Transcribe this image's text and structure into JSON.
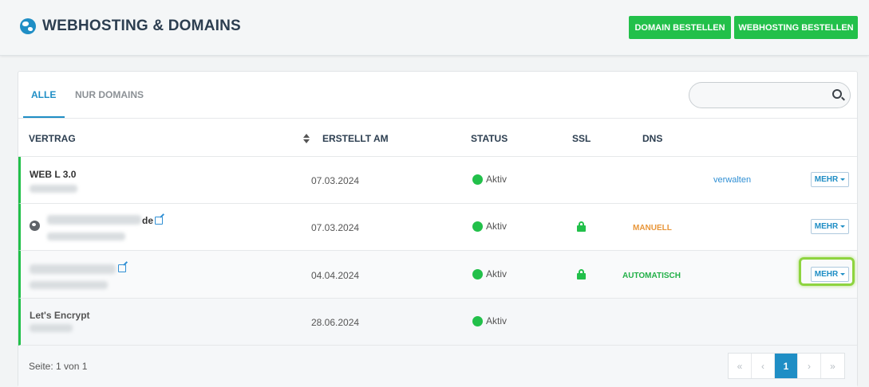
{
  "header": {
    "title": "WEBHOSTING & DOMAINS",
    "buttons": {
      "order_domain": "DOMAIN BESTELLEN",
      "order_hosting": "WEBHOSTING BESTELLEN"
    }
  },
  "tabs": {
    "all": "ALLE",
    "domains_only": "NUR DOMAINS"
  },
  "search": {
    "placeholder": ""
  },
  "table": {
    "columns": {
      "contract": "VERTRAG",
      "created": "ERSTELLT AM",
      "status": "STATUS",
      "ssl": "SSL",
      "dns": "DNS"
    },
    "rows": [
      {
        "name": "WEB L 3.0",
        "created": "07.03.2024",
        "status": "Aktiv",
        "ssl": "",
        "dns": "",
        "manage": "verwalten",
        "more": "MEHR"
      },
      {
        "name_suffix": "de",
        "created": "07.03.2024",
        "status": "Aktiv",
        "ssl": "lock",
        "dns": "MANUELL",
        "more": "MEHR"
      },
      {
        "created": "04.04.2024",
        "status": "Aktiv",
        "ssl": "lock",
        "dns": "AUTOMATISCH",
        "more": "MEHR"
      },
      {
        "name": "Let's Encrypt",
        "created": "28.06.2024",
        "status": "Aktiv"
      }
    ]
  },
  "footer": {
    "page_info": "Seite: 1 von 1",
    "pager": {
      "first": "«",
      "prev": "‹",
      "current": "1",
      "next": "›",
      "last": "»"
    }
  },
  "colors": {
    "accent": "#1f8ec5",
    "success": "#22c04a",
    "warning": "#e8963a"
  }
}
